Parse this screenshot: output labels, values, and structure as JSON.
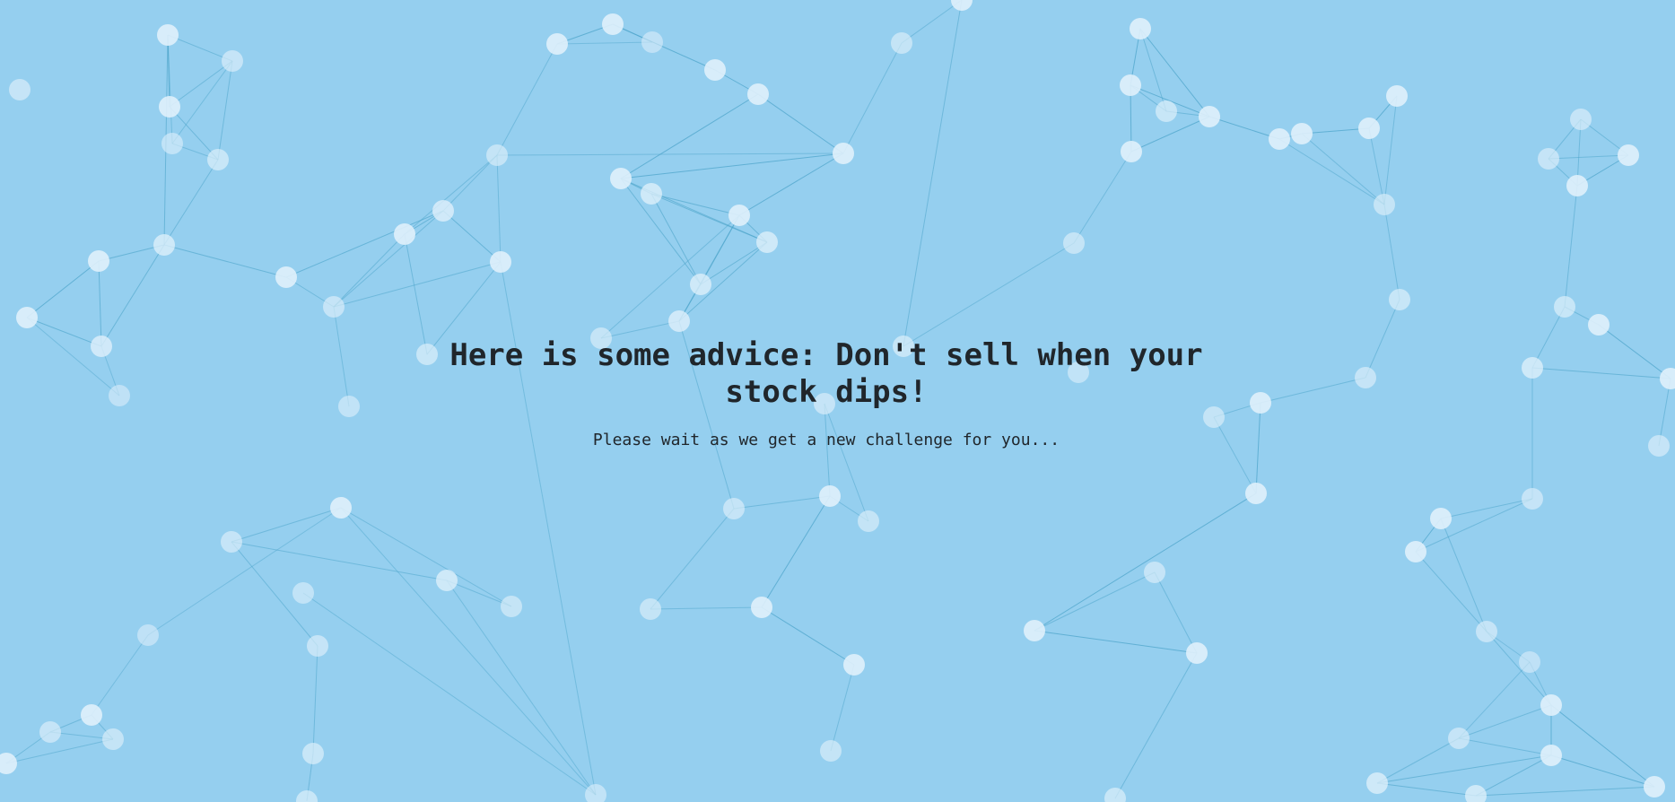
{
  "background_color": "#95cfef",
  "node_color": "#dff0fb",
  "link_color": "#4aa3c9",
  "loading": {
    "headline": "Here is some advice: Don't sell when your stock dips!",
    "subtext": "Please wait as we get a new challenge for you..."
  }
}
